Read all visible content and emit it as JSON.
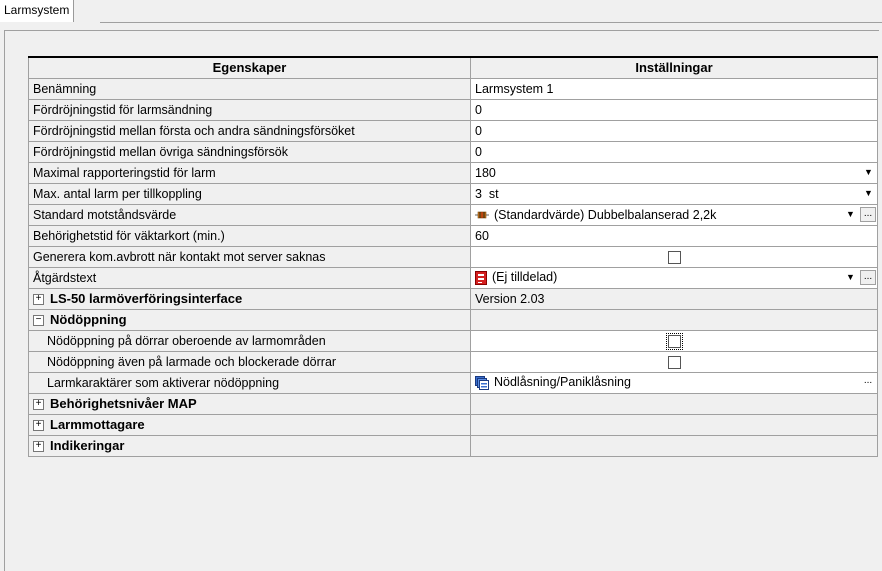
{
  "tab": {
    "label": "Larmsystem"
  },
  "grid": {
    "header": {
      "col1": "Egenskaper",
      "col2": "Inställningar"
    },
    "rows": [
      {
        "name": "Benämning",
        "value": "Larmsystem 1"
      },
      {
        "name": "Fördröjningstid för larmsändning",
        "value": "0"
      },
      {
        "name": "Fördröjningstid mellan första och andra sändningsförsöket",
        "value": "0"
      },
      {
        "name": "Fördröjningstid mellan övriga sändningsförsök",
        "value": "0"
      },
      {
        "name": "Maximal rapporteringstid för larm",
        "value": "180"
      },
      {
        "name": "Max. antal larm per tillkoppling",
        "value": "3  st"
      },
      {
        "name": "Standard motståndsvärde",
        "value": "(Standardvärde) Dubbelbalanserad 2,2k"
      },
      {
        "name": "Behörighetstid för väktarkort (min.)",
        "value": "60"
      },
      {
        "name": "Generera kom.avbrott när kontakt mot server saknas",
        "checked": false
      },
      {
        "name": "Åtgärdstext",
        "value": "(Ej tilldelad)"
      },
      {
        "name": "LS-50 larmöverföringsinterface",
        "value": "Version 2.03",
        "expander": "+"
      },
      {
        "name": "Nödöppning",
        "expander": "−"
      },
      {
        "name": "Nödöppning på dörrar oberoende av larmområden",
        "checked": false
      },
      {
        "name": "Nödöppning även på larmade och blockerade dörrar",
        "checked": false
      },
      {
        "name": "Larmkaraktärer som aktiverar nödöppning",
        "value": "Nödlåsning/Paniklåsning"
      },
      {
        "name": "Behörighetsnivåer MAP",
        "expander": "+"
      },
      {
        "name": "Larmmottagare",
        "expander": "+"
      },
      {
        "name": "Indikeringar",
        "expander": "+"
      }
    ]
  },
  "controls": {
    "dropdown_glyph": "▼",
    "ellipsis": "..."
  },
  "colors": {
    "value_bg": "#ffffff",
    "label_bg": "#f0f0f0",
    "grid_line": "#a0a0a0"
  }
}
